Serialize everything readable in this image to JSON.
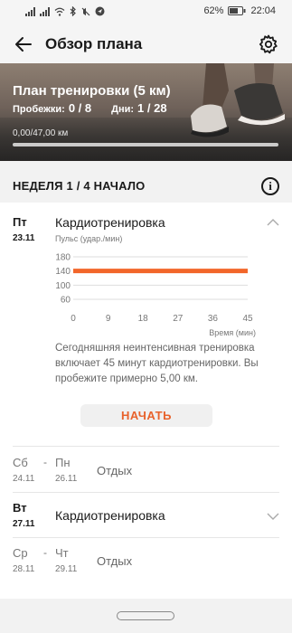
{
  "status_bar": {
    "battery": "62%",
    "time": "22:04",
    "icons": [
      "signal-icon",
      "signal-icon",
      "wifi-icon",
      "bluetooth-icon",
      "mute-icon",
      "location-icon",
      "battery-icon"
    ]
  },
  "header": {
    "title": "Обзор плана",
    "icons": [
      "back-arrow-icon",
      "gear-icon"
    ]
  },
  "hero": {
    "plan_title": "План тренировки (5 км)",
    "runs_label": "Пробежки:",
    "runs_value": "0 / 8",
    "days_label": "Дни:",
    "days_value": "1 / 28",
    "distance_text": "0,00/47,00 км",
    "progress_fraction": 0.0
  },
  "week": {
    "label": "НЕДЕЛЯ 1 / 4  НАЧАЛО",
    "info_icon": "info-icon"
  },
  "days": [
    {
      "day": "Пт",
      "date": "23.11",
      "title": "Кардиотренировка",
      "expanded": true,
      "chart_ylabel": "Пульс (удар./мин)",
      "chart_xlabel": "Время (мин)",
      "description": "Сегодняшняя неинтенсивная тренировка включает 45 минут кардиотренировки. Вы пробежите примерно 5,00 км.",
      "start_label": "НАЧАТЬ"
    },
    {
      "day_from": "Сб",
      "date_from": "24.11",
      "day_to": "Пн",
      "date_to": "26.11",
      "dash": "-",
      "title": "Отдых"
    },
    {
      "day": "Вт",
      "date": "27.11",
      "title": "Кардиотренировка",
      "expanded": false
    },
    {
      "day_from": "Ср",
      "date_from": "28.11",
      "day_to": "Чт",
      "date_to": "29.11",
      "dash": "-",
      "title": "Отдых"
    }
  ],
  "chart_data": {
    "type": "line",
    "title": "",
    "xlabel": "Время (мин)",
    "ylabel": "Пульс (удар./мин)",
    "x_ticks": [
      0,
      9,
      18,
      27,
      36,
      45
    ],
    "y_ticks": [
      180,
      140,
      100,
      60
    ],
    "xlim": [
      0,
      45
    ],
    "ylim": [
      60,
      180
    ],
    "grid": true,
    "series": [
      {
        "x": [
          0,
          45
        ],
        "y": [
          140,
          140
        ],
        "color": "#f2662a"
      }
    ]
  },
  "colors": {
    "accent": "#f2662a",
    "start_text": "#e8622c"
  }
}
